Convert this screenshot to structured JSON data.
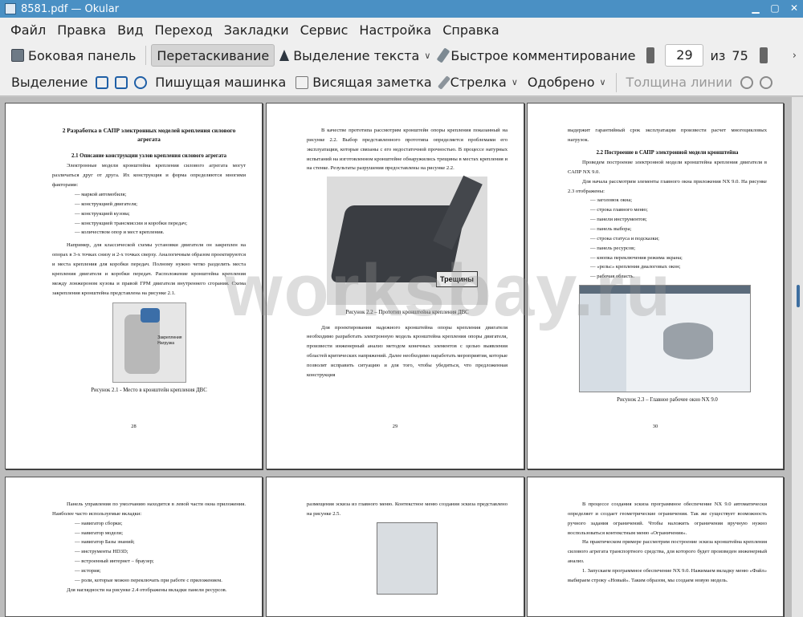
{
  "window": {
    "title": "8581.pdf — Okular"
  },
  "menu": [
    "Файл",
    "Правка",
    "Вид",
    "Переход",
    "Закладки",
    "Сервис",
    "Настройка",
    "Справка"
  ],
  "toolbar": {
    "sidebar": "Боковая панель",
    "drag": "Перетаскивание",
    "text_select": "Выделение текста",
    "quick_comment": "Быстрое комментирование",
    "page_current": "29",
    "page_of": "из",
    "page_total": "75"
  },
  "annot_toolbar": {
    "select": "Выделение",
    "typewriter": "Пишущая машинка",
    "popup_note": "Висящая заметка",
    "arrow": "Стрелка",
    "stamp": "Одобрено",
    "line_width": "Толщина линии"
  },
  "watermark": "worksbay.ru",
  "pages": {
    "p28": {
      "title": "2 Разработка в САПР электронных моделей крепления силового агрегата",
      "heading": "2.1 Описание конструкции узлов крепления силового агрегата",
      "para1": "Электронные модели кронштейна крепления силового агрегата могут различаться друг от друга. Их конструкция и форма определяются многими факторами:",
      "items": [
        "— маркой автомобиля;",
        "— конструкцией двигателя;",
        "— конструкцией кузова;",
        "— конструкцией трансмиссии и коробки передач;",
        "— количеством опор и мест крепления."
      ],
      "para2": "Например, для классической схемы установки двигателя он закреплен на опорах в 3-х точках снизу и 2-х точках сверху. Аналогичным образом проектируются и места крепления для коробки передач. Полному нужно четко разделить места крепления двигателя и коробки передач. Расположение кронштейна крепления между лонжероном кузова и правой ГРМ двигателя внутреннего сгорания. Схема закрепления кронштейна представлена на рисунке 2.1.",
      "legend": [
        "Закрепления",
        "Нагрузка"
      ],
      "caption": "Рисунок 2.1 - Место в кронштейн крепления ДВС",
      "num": "28"
    },
    "p29": {
      "para1": "В качестве прототипа рассмотрим кронштейн опоры крепления показанный на рисунке 2.2. Выбор представленного прототипа определяется проблемами его эксплуатации, которые связаны с его недостаточной прочностью. В процессе натурных испытаний на изготовленном кронштейне обнаружились трещины в местах крепления и на стенке. Результаты разрушения предоставлены на рисунке 2.2.",
      "crack_label": "Трещины",
      "caption": "Рисунок 2.2 – Прототип кронштейна крепления ДВС",
      "para2": "Для проектирования надежного кронштейна опоры крепления двигателя необходимо разработать электронную модель кронштейна крепления опоры двигателя, произвести инженерный анализ методом конечных элементов с целью выявления областей критических напряжений. Далее необходимо наработать мероприятия, которые позволят исправить ситуацию и для того, чтобы убедиться, что предложенная конструкция",
      "num": "29"
    },
    "p30": {
      "para0": "выдержит гарантийный срок эксплуатации произвести расчет многоцикловых нагрузок.",
      "heading": "2.2 Построение в САПР электронной модели кронштейна",
      "para1": "Проведем построение электронной модели кронштейна крепления двигателя в САПР NX 9.0.",
      "para2": "Для начала рассмотрим элементы главного окна приложения NX 9.0. На рисунке 2.3 отображены:",
      "items": [
        "— заголовок окна;",
        "— строка главного меню;",
        "— панели инструментов;",
        "— панель выбора;",
        "— строка статуса и подсказки;",
        "— панель ресурсов;",
        "— кнопка переключения режима экрана;",
        "— «рельс» крепления диалоговых окон;",
        "— рабочая область."
      ],
      "caption": "Рисунок 2.3 – Главное рабочее окно NX 9.0",
      "num": "30"
    },
    "p31": {
      "para1": "Панель управления по умолчанию находится в левой части окна приложения. Наиболее часто используемые вкладки:",
      "items": [
        "— навигатор сборки;",
        "— навигатор модели;",
        "— навигатор Базы знаний;",
        "— инструменты HD3D;",
        "— встроенный интернет – браузер;",
        "— история;",
        "— роли, которые можно переключать при работе с приложением."
      ],
      "para2": "Для наглядности на рисунке 2.4 отображены вкладки панели ресурсов."
    },
    "p32": {
      "para1": "размещения эскиза из главного меню. Контекстное меню создания эскиза представлено на рисунке 2.5."
    },
    "p33": {
      "para1": "В процессе создания эскиза программное обеспечение NX 9.0 автоматически определяет и создает геометрические ограничения. Так же существует возможность ручного задания ограничений. Чтобы наложить ограничения вручную нужно воспользоваться контекстным меню «Ограничения».",
      "para2": "На практическом примере рассмотрим построение эскиза кронштейна крепления силового агрегата транспортного средства, для которого будет произведен инженерный анализ.",
      "para3": "1. Запускаем программное обеспечение NX 9.0. Нажимаем вкладку меню «Файл» выбираем строку «Новый». Таким образом, мы создаем новую модель."
    }
  }
}
